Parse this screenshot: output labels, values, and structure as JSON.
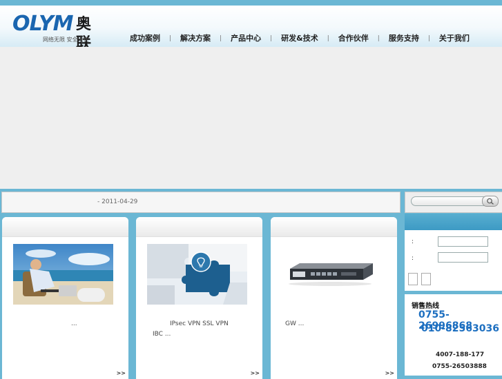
{
  "logo": {
    "brand": "OLYM",
    "cn": "奥联",
    "slogan": "网络无限  安全无忧"
  },
  "nav": {
    "items": [
      "成功案例",
      "解决方案",
      "产品中心",
      "研发&技术",
      "合作伙伴",
      "服务支持",
      "关于我们"
    ]
  },
  "news": {
    "date": "- 2011-04-29"
  },
  "search": {
    "placeholder": ""
  },
  "cards": [
    {
      "text_line1": "...",
      "text_line2": "",
      "more": ">>"
    },
    {
      "text_line1": "IPsec VPN SSL VPN",
      "text_line2": "IBC          ...",
      "more": ">>"
    },
    {
      "text_line1": "GW                          ...",
      "text_line2": "",
      "more": ">>"
    }
  ],
  "login": {
    "user_label": ":",
    "pass_label": ":"
  },
  "hotline": {
    "title": "销售热线",
    "num1": "0755-26996868",
    "num2": "010-82563036",
    "num3": "4007-188-177",
    "num4": "0755-26503888"
  },
  "colors": {
    "accent": "#1d6fc0",
    "frame": "#6bb7d4",
    "login_head": "#3d9ac4"
  }
}
